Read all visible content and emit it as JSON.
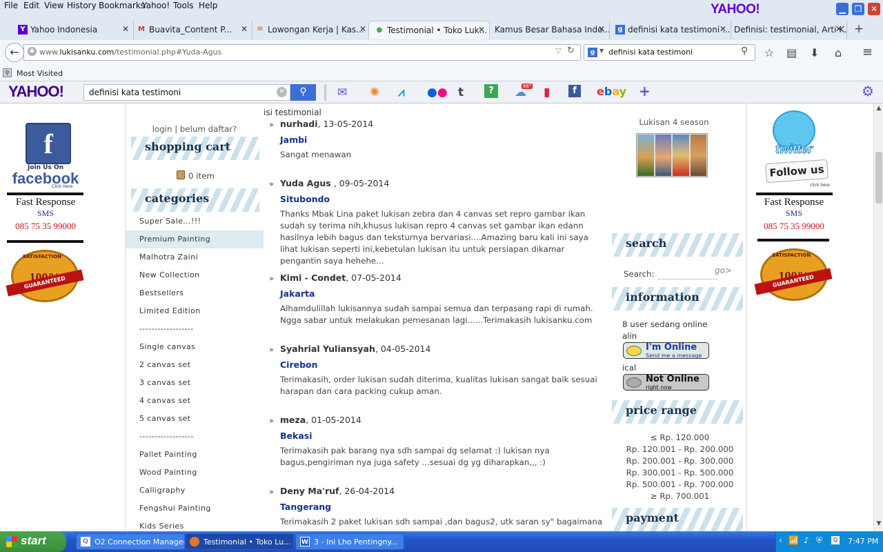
{
  "menubar": {
    "items": [
      "File",
      "Edit",
      "View",
      "History",
      "Bookmarks",
      "Yahoo!",
      "Tools",
      "Help"
    ],
    "brand": "YAHOO!"
  },
  "tabs": [
    {
      "label": "Yahoo Indonesia",
      "icon": "Y"
    },
    {
      "label": "Buavita_Content P...",
      "icon": "M"
    },
    {
      "label": "Lowongan Kerja | Kas...",
      "icon": "✉"
    },
    {
      "label": "Testimonial • Toko Luk...",
      "icon": "●"
    },
    {
      "label": "Kamus Besar Bahasa Indo...",
      "icon": ""
    },
    {
      "label": "definisi kata testimoni ...",
      "icon": "g"
    },
    {
      "label": "Definisi: testimonial, Arti K...",
      "icon": ""
    }
  ],
  "nav": {
    "url_prefix": "www.",
    "url_host": "lukisanku.com",
    "url_path": "/testimonial.php#Yuda-Agus",
    "search_value": "definisi kata testimoni"
  },
  "bookmarks": {
    "most_visited": "Most Visited"
  },
  "ytoolbar": {
    "logo": "YAHOO!",
    "search_value": "definisi kata testimoni",
    "weather_badge": "86°"
  },
  "left_ad": {
    "join": "Join Us On",
    "brand": "facebook",
    "click": "Click Here",
    "fast": "Fast Response",
    "sms": "SMS",
    "phone": "085 75 35 99000",
    "seal": "100%",
    "ribbon": "GUARANTEED",
    "satisfaction": "SATISFACTION"
  },
  "right_ad": {
    "brand": "twitter",
    "follow": "Follow us",
    "click": "click here",
    "fast": "Fast Response",
    "sms": "SMS",
    "phone": "085 75 35 99000",
    "seal": "100%",
    "ribbon": "GUARANTEED",
    "satisfaction": "SATISFACTION"
  },
  "left": {
    "login": "login | belum daftar?",
    "cart_title": "shopping cart",
    "cart_items": "0 item",
    "categories_title": "categories",
    "categories": [
      {
        "label": "Super Sale...!!!",
        "sel": false
      },
      {
        "label": "Premium Painting",
        "sel": true
      },
      {
        "label": "Malhotra Zaini",
        "sel": false
      },
      {
        "label": "New Collection",
        "sel": false
      },
      {
        "label": "Bestsellers",
        "sel": false
      },
      {
        "label": "Limited Edition",
        "sel": false
      },
      {
        "label": "------------------",
        "sel": false
      },
      {
        "label": "Single canvas",
        "sel": false
      },
      {
        "label": "2 canvas set",
        "sel": false
      },
      {
        "label": "3 canvas set",
        "sel": false
      },
      {
        "label": "4 canvas set",
        "sel": false
      },
      {
        "label": "5 canvas set",
        "sel": false
      },
      {
        "label": "------------------",
        "sel": false
      },
      {
        "label": "Pallet Painting",
        "sel": false
      },
      {
        "label": "Wood Painting",
        "sel": false
      },
      {
        "label": "Calligraphy",
        "sel": false
      },
      {
        "label": "Fengshui Painting",
        "sel": false
      },
      {
        "label": "Kids Series",
        "sel": false
      }
    ]
  },
  "main": {
    "heading": "isi testimonial",
    "testimonials": [
      {
        "name": "nurhadi",
        "date": ", 13-05-2014",
        "city": "Jambi",
        "text": "Sangat menawan"
      },
      {
        "name": "Yuda Agus",
        "date": " , 09-05-2014",
        "city": "Situbondo",
        "text": "Thanks Mbak Lina paket lukisan zebra dan 4 canvas set repro gambar ikan sudah sy terima nih,khusus lukisan repro 4 canvas set gambar ikan edann hasilnya lebih bagus dan teksturnya bervariasi....Amazing baru kali ini saya lihat lukisan seperti ini,kebetulan lukisan itu untuk persiapan dikamar pengantin saya hehehe..."
      },
      {
        "name": "Kimi - Condet",
        "date": ", 07-05-2014",
        "city": "Jakarta",
        "text": "Alhamdulillah lukisannya sudah sampai semua dan terpasang rapi di rumah. Ngga sabar untuk melakukan pemesanan lagi......Terimakasih lukisanku.com"
      },
      {
        "name": "Syahrial Yuliansyah",
        "date": ", 04-05-2014",
        "city": "Cirebon",
        "text": "Terimakasih, order lukisan sudah diterima, kualitas lukisan sangat baik sesuai harapan dan cara packing cukup aman."
      },
      {
        "name": "meza",
        "date": ", 01-05-2014",
        "city": "Bekasi",
        "text": "Terimakasih pak barang nya sdh sampai dg selamat :) lukisan nya bagus,pengiriman nya juga safety ...sesuai dg yg diharapkan,,, :)"
      },
      {
        "name": "Deny Ma'ruf",
        "date": ", 26-04-2014",
        "city": "Tangerang",
        "text": "Terimakasih 2 paket lukisan sdh sampai ,dan bagus2, utk saran sy\" bagaimana"
      }
    ]
  },
  "right": {
    "featured_label": "Lukisan 4 season",
    "search_title": "search",
    "search_label": "Search:",
    "search_go": "go>",
    "info_title": "information",
    "online_count": "8 user sedang online",
    "user1": "alin",
    "btn_online": "I'm Online",
    "btn_online_sub": "Send me a message",
    "user2": "ical",
    "btn_offline": "Not Online",
    "btn_offline_sub": "right now",
    "price_title": "price range",
    "prices": [
      "≤ Rp. 120.000",
      "Rp. 120.001 - Rp. 200.000",
      "Rp. 200.001 - Rp. 300.000",
      "Rp. 300.001 - Rp. 500.000",
      "Rp. 500.001 - Rp. 700.000",
      "≥ Rp. 700.001"
    ],
    "payment_title": "payment"
  },
  "taskbar": {
    "start": "start",
    "tasks": [
      "O2 Connection Manager",
      "Testimonial • Toko Lu...",
      "3 - Ini Lho Pentingny..."
    ],
    "clock": "7:47 PM"
  }
}
